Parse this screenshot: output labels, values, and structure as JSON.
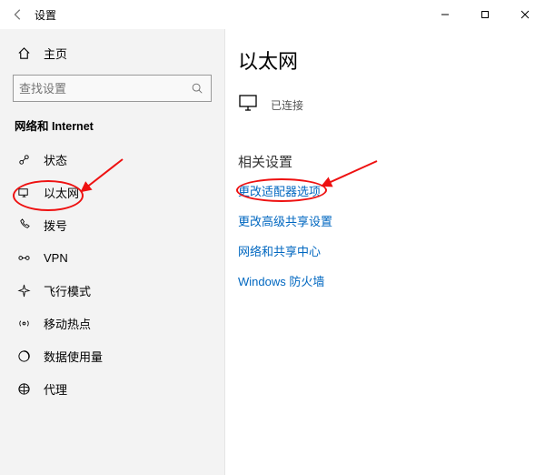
{
  "titlebar": {
    "title": "设置"
  },
  "sidebar": {
    "home": "主页",
    "search_placeholder": "查找设置",
    "section": "网络和 Internet",
    "items": [
      {
        "icon": "status",
        "label": "状态"
      },
      {
        "icon": "ethernet",
        "label": "以太网"
      },
      {
        "icon": "dialup",
        "label": "拨号"
      },
      {
        "icon": "vpn",
        "label": "VPN"
      },
      {
        "icon": "airplane",
        "label": "飞行模式"
      },
      {
        "icon": "hotspot",
        "label": "移动热点"
      },
      {
        "icon": "datausage",
        "label": "数据使用量"
      },
      {
        "icon": "proxy",
        "label": "代理"
      }
    ]
  },
  "content": {
    "heading": "以太网",
    "connection": {
      "name": " ",
      "status": "已连接"
    },
    "related_heading": "相关设置",
    "links": [
      "更改适配器选项",
      "更改高级共享设置",
      "网络和共享中心",
      "Windows 防火墙"
    ]
  }
}
